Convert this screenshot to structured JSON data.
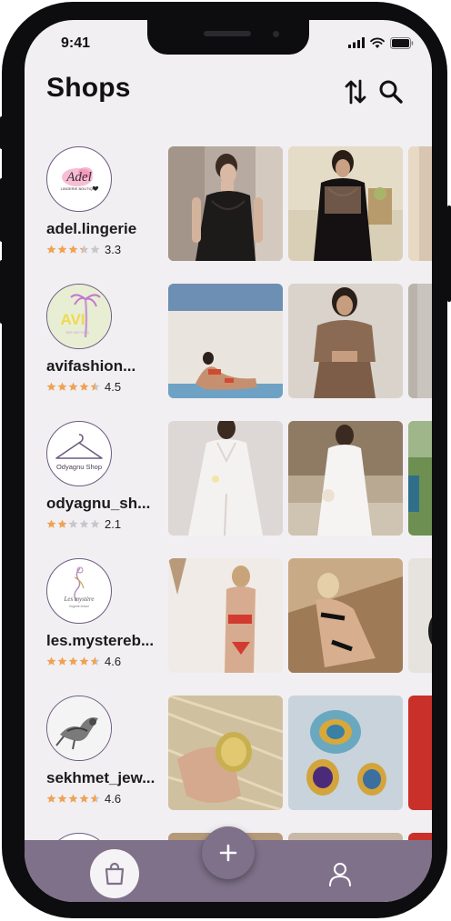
{
  "status": {
    "time": "9:41"
  },
  "header": {
    "title": "Shops",
    "sort_icon": "sort-arrows-icon",
    "search_icon": "search-icon"
  },
  "shops": [
    {
      "name": "adel.lingerie",
      "rating": "3.3",
      "rating_value": 3.3,
      "logo": {
        "main": "Adel",
        "sub": "LINGERIE BOUTIQUE"
      }
    },
    {
      "name": "avifashion...",
      "rating": "4.5",
      "rating_value": 4.5,
      "logo": {
        "main": "AVI",
        "sub": "SEE BEYOND"
      }
    },
    {
      "name": "odyagnu_sh...",
      "rating": "2.1",
      "rating_value": 2.1,
      "logo": {
        "main": "Odyagnu Shop"
      }
    },
    {
      "name": "les.mystereb...",
      "rating": "4.6",
      "rating_value": 4.6,
      "logo": {
        "main": "Les mystère",
        "sub": "lingerie brand"
      }
    },
    {
      "name": "sekhmet_jew...",
      "rating": "4.6",
      "rating_value": 4.6
    }
  ],
  "tabbar": {
    "shop_icon": "shopping-bag-icon",
    "add_icon": "plus-icon",
    "profile_icon": "user-icon"
  },
  "colors": {
    "accent": "#7e7189",
    "background": "#f1eff2",
    "star": "#f0a254",
    "star_empty": "#c8c6cb"
  }
}
